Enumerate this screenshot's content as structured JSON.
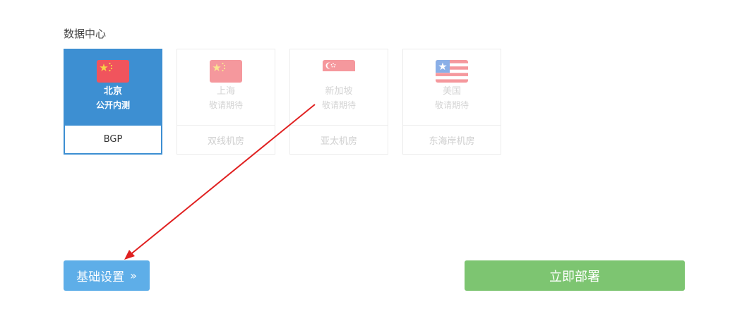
{
  "section_title": "数据中心",
  "datacenters": [
    {
      "name": "北京",
      "status": "公开内测",
      "line": "BGP",
      "selected": true,
      "flag_icon": "china-flag-icon"
    },
    {
      "name": "上海",
      "status": "敬请期待",
      "line": "双线机房",
      "selected": false,
      "flag_icon": "china-flag-icon"
    },
    {
      "name": "新加坡",
      "status": "敬请期待",
      "line": "亚太机房",
      "selected": false,
      "flag_icon": "singapore-flag-icon"
    },
    {
      "name": "美国",
      "status": "敬请期待",
      "line": "东海岸机房",
      "selected": false,
      "flag_icon": "usa-flag-icon"
    }
  ],
  "buttons": {
    "basic_settings": "基础设置",
    "basic_settings_chevron": "»",
    "deploy": "立即部署"
  },
  "colors": {
    "selected_card": "#3d8fd2",
    "basic_button": "#5eaee8",
    "deploy_button": "#7dc571",
    "annotation_arrow": "#e02020"
  }
}
